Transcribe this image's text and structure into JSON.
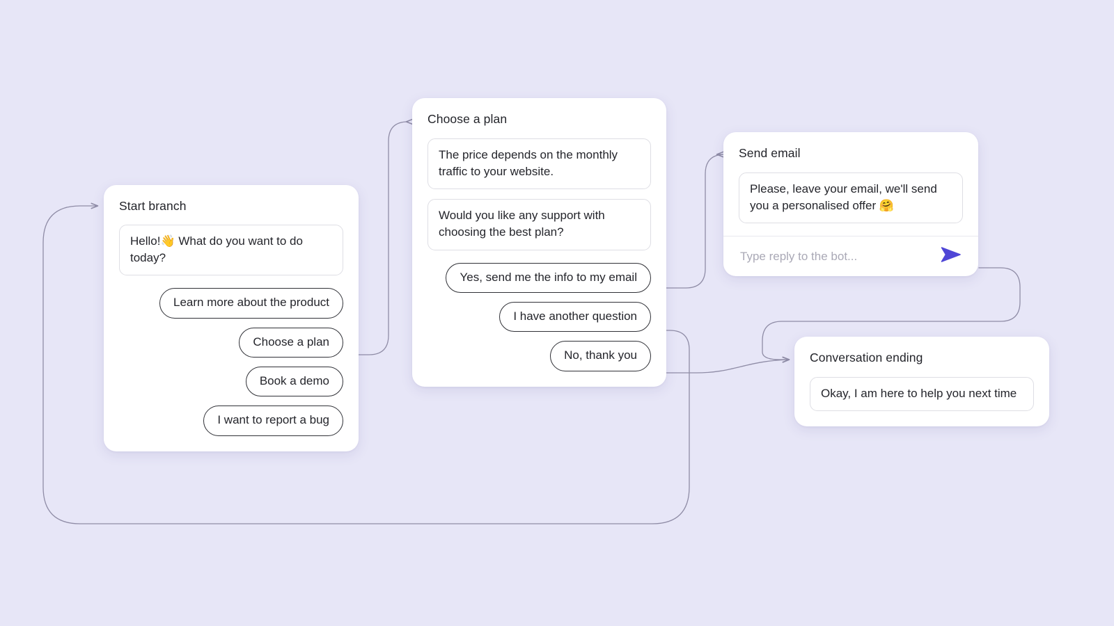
{
  "canvas": {
    "background_color": "#e7e6f7",
    "edge_color": "#8f8ca6",
    "accent_color": "#4f46d6"
  },
  "nodes": [
    {
      "id": "start",
      "title": "Start branch",
      "messages": [
        "Hello!👋 What do you want to do today?"
      ],
      "choices": [
        "Learn more about the product",
        "Choose a plan",
        "Book a demo",
        "I want to report a bug"
      ]
    },
    {
      "id": "plan",
      "title": "Choose a plan",
      "messages": [
        "The price depends on the monthly traffic to your website.",
        "Would you like any support with choosing the best plan?"
      ],
      "choices": [
        "Yes, send me the info to my email",
        "I have another question",
        "No, thank you"
      ]
    },
    {
      "id": "email",
      "title": "Send email",
      "messages": [
        "Please, leave your email, we'll send you a personalised offer 🤗"
      ],
      "reply": {
        "placeholder": "Type reply to the bot...",
        "value": "",
        "send_icon": "send-paper-plane-icon"
      }
    },
    {
      "id": "ending",
      "title": "Conversation ending",
      "messages": [
        "Okay, I am here to help you next time"
      ]
    }
  ]
}
